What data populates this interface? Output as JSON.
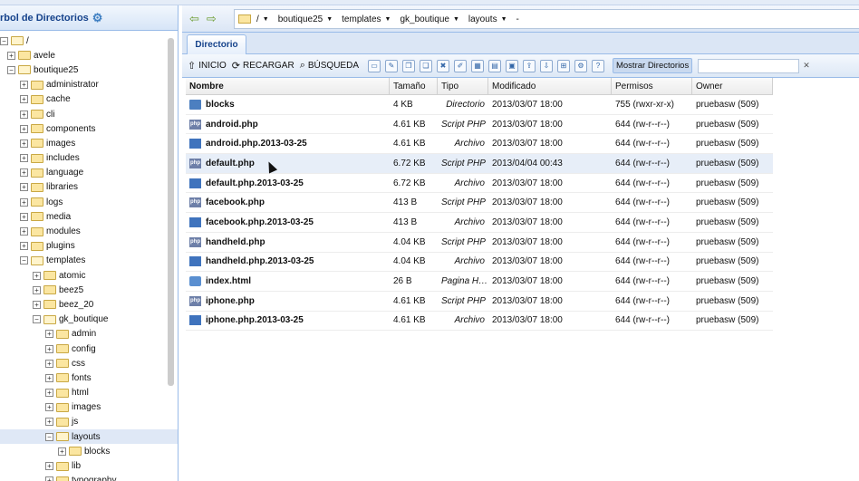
{
  "tree": {
    "title": "rbol de Directorios",
    "root_label": "/",
    "items": [
      {
        "label": "avele",
        "indent": 1,
        "toggle": "+",
        "open": false
      },
      {
        "label": "boutique25",
        "indent": 1,
        "toggle": "-",
        "open": true
      },
      {
        "label": "administrator",
        "indent": 2,
        "toggle": "+",
        "open": false
      },
      {
        "label": "cache",
        "indent": 2,
        "toggle": "+",
        "open": false
      },
      {
        "label": "cli",
        "indent": 2,
        "toggle": "+",
        "open": false
      },
      {
        "label": "components",
        "indent": 2,
        "toggle": "+",
        "open": false
      },
      {
        "label": "images",
        "indent": 2,
        "toggle": "+",
        "open": false
      },
      {
        "label": "includes",
        "indent": 2,
        "toggle": "+",
        "open": false
      },
      {
        "label": "language",
        "indent": 2,
        "toggle": "+",
        "open": false
      },
      {
        "label": "libraries",
        "indent": 2,
        "toggle": "+",
        "open": false
      },
      {
        "label": "logs",
        "indent": 2,
        "toggle": "+",
        "open": false
      },
      {
        "label": "media",
        "indent": 2,
        "toggle": "+",
        "open": false
      },
      {
        "label": "modules",
        "indent": 2,
        "toggle": "+",
        "open": false
      },
      {
        "label": "plugins",
        "indent": 2,
        "toggle": "+",
        "open": false
      },
      {
        "label": "templates",
        "indent": 2,
        "toggle": "-",
        "open": true
      },
      {
        "label": "atomic",
        "indent": 3,
        "toggle": "+",
        "open": false
      },
      {
        "label": "beez5",
        "indent": 3,
        "toggle": "+",
        "open": false
      },
      {
        "label": "beez_20",
        "indent": 3,
        "toggle": "+",
        "open": false
      },
      {
        "label": "gk_boutique",
        "indent": 3,
        "toggle": "-",
        "open": true
      },
      {
        "label": "admin",
        "indent": 4,
        "toggle": "+",
        "open": false
      },
      {
        "label": "config",
        "indent": 4,
        "toggle": "+",
        "open": false
      },
      {
        "label": "css",
        "indent": 4,
        "toggle": "+",
        "open": false
      },
      {
        "label": "fonts",
        "indent": 4,
        "toggle": "+",
        "open": false
      },
      {
        "label": "html",
        "indent": 4,
        "toggle": "+",
        "open": false
      },
      {
        "label": "images",
        "indent": 4,
        "toggle": "+",
        "open": false
      },
      {
        "label": "js",
        "indent": 4,
        "toggle": "+",
        "open": false
      },
      {
        "label": "layouts",
        "indent": 4,
        "toggle": "-",
        "open": true,
        "selected": true
      },
      {
        "label": "blocks",
        "indent": 5,
        "toggle": "+",
        "open": false
      },
      {
        "label": "lib",
        "indent": 4,
        "toggle": "+",
        "open": false
      },
      {
        "label": "typography",
        "indent": 4,
        "toggle": "+",
        "open": false
      }
    ]
  },
  "breadcrumb": {
    "parts": [
      "/",
      "boutique25",
      "templates",
      "gk_boutique",
      "layouts",
      "-"
    ]
  },
  "tab": {
    "label": "Directorio"
  },
  "toolbar": {
    "home_label": "INICIO",
    "reload_label": "RECARGAR",
    "search_label": "BÚSQUEDA",
    "show_dirs_label": "Mostrar Directorios",
    "icons": [
      "new-file-icon",
      "edit-icon",
      "copy-icon",
      "paste-icon",
      "delete-icon",
      "rename-icon",
      "chmod-icon",
      "view-icon",
      "archive-icon",
      "upload-icon",
      "download-icon",
      "extract-icon",
      "settings-icon",
      "help-icon"
    ]
  },
  "grid": {
    "headers": [
      "Nombre",
      "Tamaño",
      "Tipo",
      "Modificado",
      "Permisos",
      "Owner"
    ],
    "rows": [
      {
        "name": "blocks",
        "icon": "folder",
        "size": "4 KB",
        "type": "Directorio",
        "modified": "2013/03/07 18:00",
        "perms": "755 (rwxr-xr-x)",
        "owner": "pruebasw (509)"
      },
      {
        "name": "android.php",
        "icon": "php",
        "size": "4.61 KB",
        "type": "Script PHP",
        "modified": "2013/03/07 18:00",
        "perms": "644 (rw-r--r--)",
        "owner": "pruebasw (509)"
      },
      {
        "name": "android.php.2013-03-25",
        "icon": "file",
        "size": "4.61 KB",
        "type": "Archivo",
        "modified": "2013/03/07 18:00",
        "perms": "644 (rw-r--r--)",
        "owner": "pruebasw (509)"
      },
      {
        "name": "default.php",
        "icon": "php",
        "size": "6.72 KB",
        "type": "Script PHP",
        "modified": "2013/04/04 00:43",
        "perms": "644 (rw-r--r--)",
        "owner": "pruebasw (509)",
        "highlight": true
      },
      {
        "name": "default.php.2013-03-25",
        "icon": "file",
        "size": "6.72 KB",
        "type": "Archivo",
        "modified": "2013/03/07 18:00",
        "perms": "644 (rw-r--r--)",
        "owner": "pruebasw (509)"
      },
      {
        "name": "facebook.php",
        "icon": "php",
        "size": "413 B",
        "type": "Script PHP",
        "modified": "2013/03/07 18:00",
        "perms": "644 (rw-r--r--)",
        "owner": "pruebasw (509)"
      },
      {
        "name": "facebook.php.2013-03-25",
        "icon": "file",
        "size": "413 B",
        "type": "Archivo",
        "modified": "2013/03/07 18:00",
        "perms": "644 (rw-r--r--)",
        "owner": "pruebasw (509)"
      },
      {
        "name": "handheld.php",
        "icon": "php",
        "size": "4.04 KB",
        "type": "Script PHP",
        "modified": "2013/03/07 18:00",
        "perms": "644 (rw-r--r--)",
        "owner": "pruebasw (509)"
      },
      {
        "name": "handheld.php.2013-03-25",
        "icon": "file",
        "size": "4.04 KB",
        "type": "Archivo",
        "modified": "2013/03/07 18:00",
        "perms": "644 (rw-r--r--)",
        "owner": "pruebasw (509)"
      },
      {
        "name": "index.html",
        "icon": "html",
        "size": "26 B",
        "type": "Pagina H…",
        "modified": "2013/03/07 18:00",
        "perms": "644 (rw-r--r--)",
        "owner": "pruebasw (509)"
      },
      {
        "name": "iphone.php",
        "icon": "php",
        "size": "4.61 KB",
        "type": "Script PHP",
        "modified": "2013/03/07 18:00",
        "perms": "644 (rw-r--r--)",
        "owner": "pruebasw (509)"
      },
      {
        "name": "iphone.php.2013-03-25",
        "icon": "file",
        "size": "4.61 KB",
        "type": "Archivo",
        "modified": "2013/03/07 18:00",
        "perms": "644 (rw-r--r--)",
        "owner": "pruebasw (509)"
      }
    ]
  }
}
